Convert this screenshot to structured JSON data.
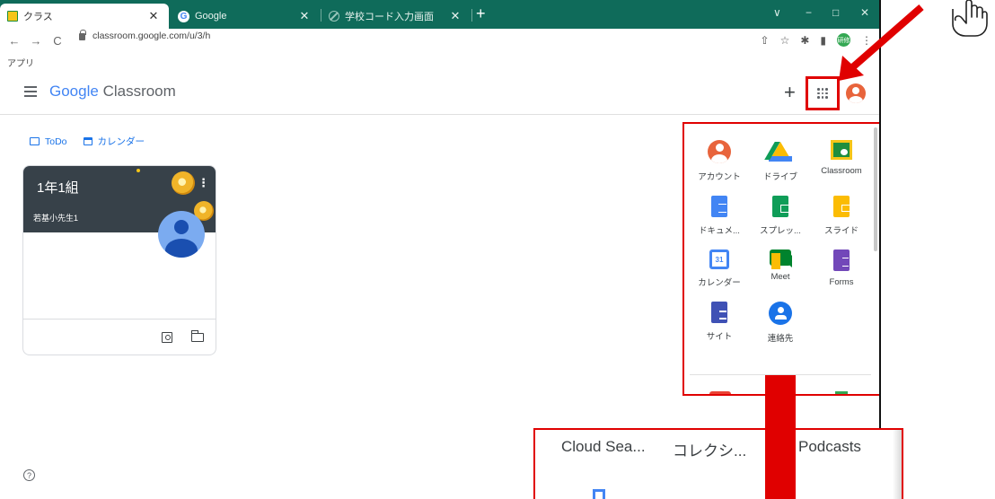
{
  "browser": {
    "tabs": [
      {
        "title": "クラス",
        "active": true
      },
      {
        "title": "Google",
        "active": false
      },
      {
        "title": "学校コード入力画面",
        "active": false
      }
    ],
    "new_tab": "+",
    "url": "classroom.google.com/u/3/h",
    "bookmarks_label": "アプリ",
    "profile_avatar_text": "研修",
    "window_controls": [
      "∨",
      "−",
      "□",
      "✕"
    ]
  },
  "classroom": {
    "logo_google": "Google",
    "logo_product": "Classroom",
    "plus": "+",
    "nav": {
      "todo": "ToDo",
      "calendar": "カレンダー"
    },
    "card": {
      "title": "1年1組",
      "teacher": "若基小先生1"
    }
  },
  "apps_menu": {
    "apps": [
      {
        "label": "アカウント",
        "icon": "account-icon"
      },
      {
        "label": "ドライブ",
        "icon": "drive-icon"
      },
      {
        "label": "Classroom",
        "icon": "classroom-icon"
      },
      {
        "label": "ドキュメ...",
        "icon": "docs-icon"
      },
      {
        "label": "スプレッ...",
        "icon": "sheets-icon"
      },
      {
        "label": "スライド",
        "icon": "slides-icon"
      },
      {
        "label": "カレンダー",
        "icon": "calendar-icon"
      },
      {
        "label": "Meet",
        "icon": "meet-icon"
      },
      {
        "label": "Forms",
        "icon": "forms-icon"
      },
      {
        "label": "サイト",
        "icon": "sites-icon"
      },
      {
        "label": "連絡先",
        "icon": "contacts-icon"
      }
    ],
    "calendar_day": "31"
  },
  "zoom_inset": {
    "labels": [
      "Cloud Sea...",
      "コレクシ...",
      "Podcasts"
    ]
  },
  "colors": {
    "highlight": "#e00000",
    "tabstrip": "#0f6b5a",
    "card_header": "#374149"
  }
}
